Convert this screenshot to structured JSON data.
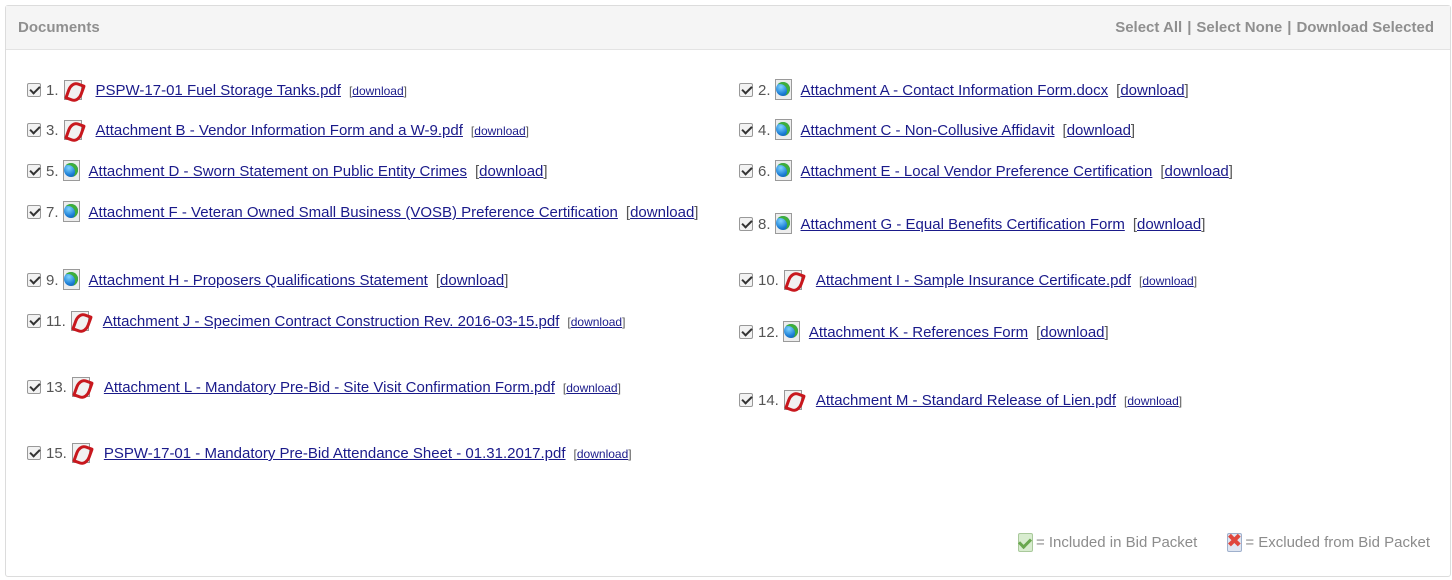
{
  "header": {
    "title": "Documents",
    "select_all": "Select All",
    "select_none": "Select None",
    "download_selected": "Download Selected",
    "separator": "|"
  },
  "documents": [
    {
      "num": "1.",
      "icon": "pdf-icon",
      "name": "PSPW-17-01 Fuel Storage Tanks.pdf",
      "download": "download",
      "checked": true
    },
    {
      "num": "2.",
      "icon": "web-document-icon",
      "name": "Attachment A - Contact Information Form.docx",
      "download": "download",
      "checked": true
    },
    {
      "num": "3.",
      "icon": "pdf-icon",
      "name": "Attachment B - Vendor Information Form and a W-9.pdf",
      "download": "download",
      "checked": true
    },
    {
      "num": "4.",
      "icon": "web-document-icon",
      "name": "Attachment C - Non-Collusive Affidavit",
      "download": "download",
      "checked": true
    },
    {
      "num": "5.",
      "icon": "web-document-icon",
      "name": "Attachment D - Sworn Statement on Public Entity Crimes",
      "download": "download",
      "checked": true
    },
    {
      "num": "6.",
      "icon": "web-document-icon",
      "name": "Attachment E - Local Vendor Preference Certification",
      "download": "download",
      "checked": true
    },
    {
      "num": "7.",
      "icon": "web-document-icon",
      "name": "Attachment F - Veteran Owned Small Business (VOSB) Preference Certification",
      "download": "download",
      "checked": true
    },
    {
      "num": "8.",
      "icon": "web-document-icon",
      "name": "Attachment G - Equal Benefits Certification Form",
      "download": "download",
      "checked": true
    },
    {
      "num": "9.",
      "icon": "web-document-icon",
      "name": "Attachment H - Proposers Qualifications Statement",
      "download": "download",
      "checked": true
    },
    {
      "num": "10.",
      "icon": "pdf-icon",
      "name": "Attachment I - Sample Insurance Certificate.pdf",
      "download": "download",
      "checked": true
    },
    {
      "num": "11.",
      "icon": "pdf-icon",
      "name": "Attachment J - Specimen Contract Construction Rev. 2016-03-15.pdf",
      "download": "download",
      "checked": true
    },
    {
      "num": "12.",
      "icon": "web-document-icon",
      "name": "Attachment K - References Form",
      "download": "download",
      "checked": true
    },
    {
      "num": "13.",
      "icon": "pdf-icon",
      "name": "Attachment L - Mandatory Pre-Bid - Site Visit Confirmation Form.pdf",
      "download": "download",
      "checked": true
    },
    {
      "num": "14.",
      "icon": "pdf-icon",
      "name": "Attachment M - Standard Release of Lien.pdf",
      "download": "download",
      "checked": true
    },
    {
      "num": "15.",
      "icon": "pdf-icon",
      "name": "PSPW-17-01 - Mandatory Pre-Bid Attendance Sheet - 01.31.2017.pdf",
      "download": "download",
      "checked": true
    }
  ],
  "legend": {
    "included_icon": "included-check-icon",
    "included": "= Included in Bid Packet",
    "excluded_icon": "excluded-x-icon",
    "excluded": "= Excluded from Bid Packet"
  }
}
